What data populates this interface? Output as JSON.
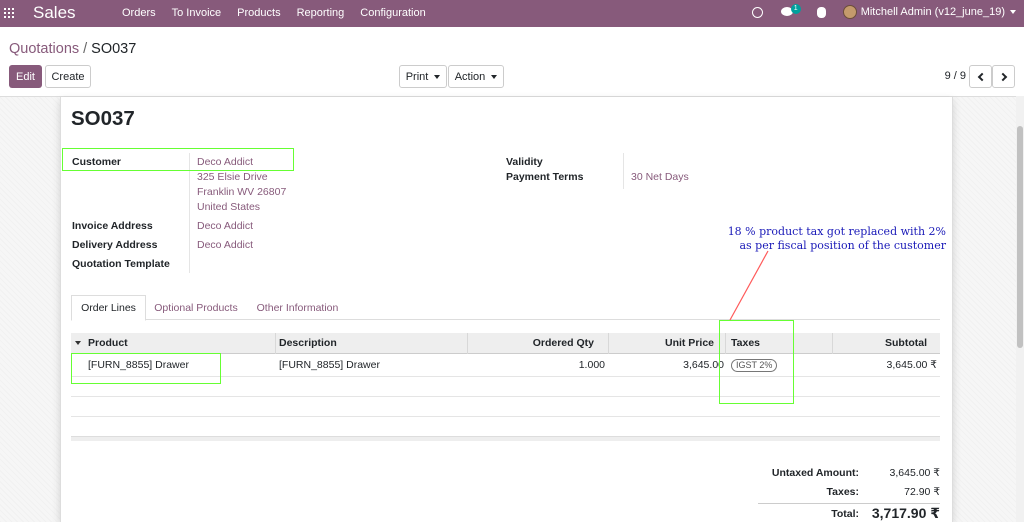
{
  "navbar": {
    "brand": "Sales",
    "menu": [
      "Orders",
      "To Invoice",
      "Products",
      "Reporting",
      "Configuration"
    ],
    "chat_badge": "1",
    "user": "Mitchell Admin (v12_june_19)"
  },
  "breadcrumb": {
    "parent": "Quotations",
    "separator": "/",
    "current": "SO037"
  },
  "buttons": {
    "edit": "Edit",
    "create": "Create",
    "print": "Print",
    "action": "Action"
  },
  "pager": "9 / 9",
  "form": {
    "title": "SO037",
    "customer_label": "Customer",
    "customer_name": "Deco Addict",
    "customer_address": [
      "325 Elsie Drive",
      "Franklin WV 26807",
      "United States"
    ],
    "invoice_address_label": "Invoice Address",
    "invoice_address": "Deco Addict",
    "delivery_address_label": "Delivery Address",
    "delivery_address": "Deco Addict",
    "quotation_template_label": "Quotation Template",
    "validity_label": "Validity",
    "payment_terms_label": "Payment Terms",
    "payment_terms": "30 Net Days"
  },
  "tabs": [
    "Order Lines",
    "Optional Products",
    "Other Information"
  ],
  "table": {
    "headers": [
      "Product",
      "Description",
      "Ordered Qty",
      "Unit Price",
      "Taxes",
      "Subtotal"
    ],
    "rows": [
      {
        "product": "[FURN_8855] Drawer",
        "description": "[FURN_8855] Drawer",
        "qty": "1.000",
        "unit_price": "3,645.00",
        "tax": "IGST 2%",
        "subtotal": "3,645.00 ₹"
      }
    ]
  },
  "totals": {
    "untaxed_label": "Untaxed Amount:",
    "untaxed_value": "3,645.00 ₹",
    "taxes_label": "Taxes:",
    "taxes_value": "72.90 ₹",
    "total_label": "Total:",
    "total_value": "3,717.90 ₹"
  },
  "annotation": {
    "line1": "18 % product tax got replaced with 2%",
    "line2": "as per fiscal position of the customer",
    "highlight_color": "#66ff33",
    "text_color": "#1a1ab8",
    "arrow_color": "#ff5a5a"
  },
  "colors": {
    "brand": "#875a7b",
    "link": "#875a7b"
  }
}
